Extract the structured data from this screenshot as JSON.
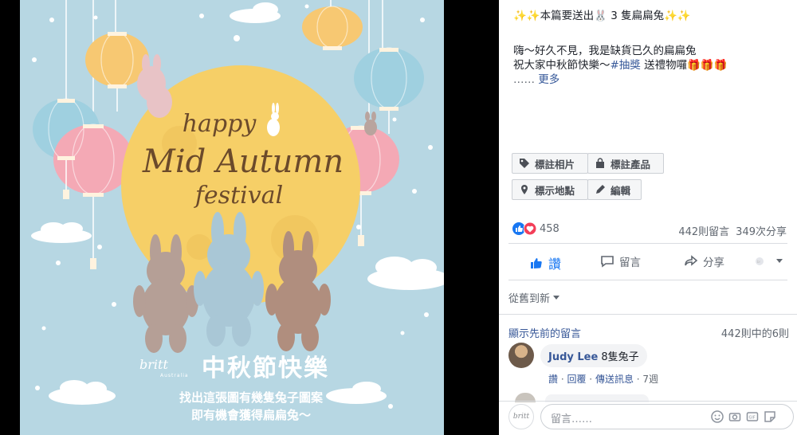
{
  "poster": {
    "script_line1": "happy",
    "script_line2": "Mid Autumn",
    "script_line3": "festival",
    "brand_logo": "britt",
    "brand_sub": "Australia",
    "headline": "中秋節快樂",
    "caption_line1": "找出這張圖有幾隻兔子圖案",
    "caption_line2": "即有機會獲得扁扁兔～"
  },
  "post": {
    "title": "本篇要送出🐰 3 隻扁扁兔",
    "title_deco": "✨✨",
    "line1": "嗨～好久不見，我是缺貨已久的扁扁兔",
    "line2_prefix": "祝大家中秋節快樂～",
    "hashtag": "#抽獎",
    "line2_suffix": " 送禮物囉",
    "line2_emoji": "🎁🎁🎁",
    "ellipsis": "……",
    "more_link": "更多"
  },
  "photo_actions": {
    "tag_photo": "標註相片",
    "tag_product": "標註產品",
    "add_location": "標示地點",
    "edit": "編輯"
  },
  "stats": {
    "reactions_count": "458",
    "comments_count": "442則留言",
    "shares_count": "349次分享"
  },
  "actions": {
    "like": "讚",
    "comment": "留言",
    "share": "分享"
  },
  "comments": {
    "sort_label": "從舊到新",
    "show_previous": "顯示先前的留言",
    "count_label": "442則中的6則",
    "items": [
      {
        "author": "Judy Lee",
        "text": "8隻兔子",
        "like": "讚",
        "reply": "回覆",
        "message": "傳送訊息",
        "time": "7週"
      }
    ]
  },
  "composer": {
    "placeholder": "留言……",
    "avatar_text": "britt"
  },
  "colors": {
    "facebook_blue": "#365899",
    "like_blue": "#1877f2",
    "heart_red": "#f33e58",
    "poster_bg": "#b7d7e3",
    "moon": "#f6cf67"
  }
}
